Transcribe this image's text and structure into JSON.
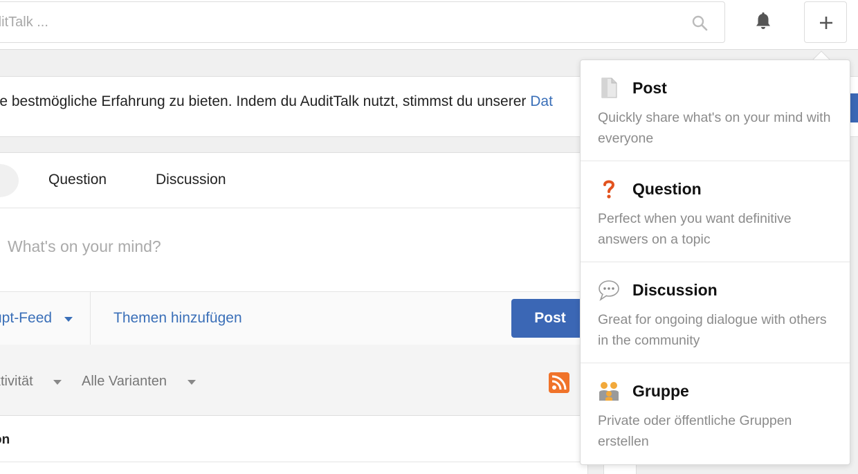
{
  "header": {
    "search_placeholder": "ditTalk ...",
    "search_icon": "search-icon",
    "bell_icon": "bell-icon",
    "add_icon": "plus-icon"
  },
  "cookie_banner": {
    "text": "lie bestmögliche Erfahrung zu bieten. Indem du AuditTalk nutzt, stimmst du unserer ",
    "link": "Dat"
  },
  "composer": {
    "tabs": [
      {
        "label": "Question"
      },
      {
        "label": "Discussion"
      }
    ],
    "placeholder": "What's on your mind?",
    "feed_select": "upt-Feed",
    "add_topics": "Themen hinzufügen",
    "post_button": "Post"
  },
  "filters": {
    "activity": "ktivität",
    "variants": "Alle Varianten"
  },
  "feed": {
    "heading": "on"
  },
  "dropdown": {
    "items": [
      {
        "icon": "document-icon",
        "title": "Post",
        "description": "Quickly share what's on your mind with everyone"
      },
      {
        "icon": "question-icon",
        "title": "Question",
        "description": "Perfect when you want definitive answers on a topic"
      },
      {
        "icon": "speech-bubble-icon",
        "title": "Discussion",
        "description": "Great for ongoing dialogue with others in the community"
      },
      {
        "icon": "group-icon",
        "title": "Gruppe",
        "description": "Private oder öffentliche Gruppen erstellen"
      }
    ]
  },
  "colors": {
    "accent": "#3b67b5",
    "link": "#3a6fb8",
    "rss": "#f0732a",
    "question_mark": "#e2531f"
  }
}
